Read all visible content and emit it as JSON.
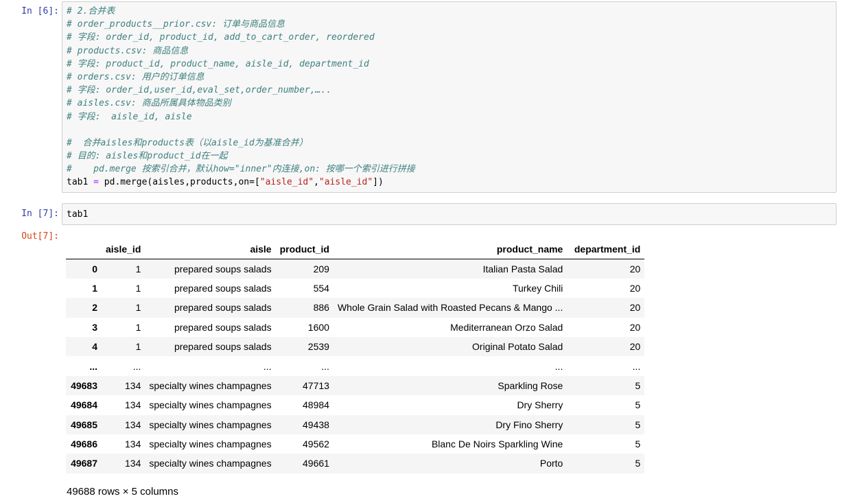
{
  "cell6": {
    "prompt": "In  [6]:",
    "lines": [
      {
        "type": "comment",
        "text": "# 2.合并表"
      },
      {
        "type": "comment",
        "text": "# order_products__prior.csv: 订单与商品信息"
      },
      {
        "type": "comment",
        "text": "# 字段: order_id, product_id, add_to_cart_order, reordered"
      },
      {
        "type": "comment",
        "text": "# products.csv: 商品信息"
      },
      {
        "type": "comment",
        "text": "# 字段: product_id, product_name, aisle_id, department_id"
      },
      {
        "type": "comment",
        "text": "# orders.csv: 用户的订单信息"
      },
      {
        "type": "comment",
        "text": "# 字段: order_id,user_id,eval_set,order_number,….."
      },
      {
        "type": "comment",
        "text": "# aisles.csv: 商品所属具体物品类别"
      },
      {
        "type": "comment",
        "text": "# 字段:  aisle_id, aisle"
      },
      {
        "type": "blank",
        "text": ""
      },
      {
        "type": "comment",
        "text": "#  合并aisles和products表（以aisle_id为基准合并）"
      },
      {
        "type": "comment",
        "text": "# 目的: aisles和product_id在一起"
      },
      {
        "type": "comment",
        "text": "#    pd.merge 按索引合并，默认how=\"inner\"内连接,on: 按哪一个索引进行拼接"
      },
      {
        "type": "code",
        "parts": {
          "a": "tab1 ",
          "op": "=",
          "b": " pd.merge(aisles,products,on=[",
          "s1": "\"aisle_id\"",
          "c": ",",
          "s2": "\"aisle_id\"",
          "d": "])"
        }
      }
    ]
  },
  "cell7": {
    "in_prompt": "In  [7]:",
    "code": "tab1",
    "out_prompt": "Out[7]:"
  },
  "dataframe": {
    "columns": [
      "",
      "aisle_id",
      "aisle",
      "product_id",
      "product_name",
      "department_id"
    ],
    "rows": [
      [
        "0",
        "1",
        "prepared soups salads",
        "209",
        "Italian Pasta Salad",
        "20"
      ],
      [
        "1",
        "1",
        "prepared soups salads",
        "554",
        "Turkey Chili",
        "20"
      ],
      [
        "2",
        "1",
        "prepared soups salads",
        "886",
        "Whole Grain Salad with Roasted Pecans & Mango ...",
        "20"
      ],
      [
        "3",
        "1",
        "prepared soups salads",
        "1600",
        "Mediterranean Orzo Salad",
        "20"
      ],
      [
        "4",
        "1",
        "prepared soups salads",
        "2539",
        "Original Potato Salad",
        "20"
      ],
      [
        "...",
        "...",
        "...",
        "...",
        "...",
        "..."
      ],
      [
        "49683",
        "134",
        "specialty wines champagnes",
        "47713",
        "Sparkling Rose",
        "5"
      ],
      [
        "49684",
        "134",
        "specialty wines champagnes",
        "48984",
        "Dry Sherry",
        "5"
      ],
      [
        "49685",
        "134",
        "specialty wines champagnes",
        "49438",
        "Dry Fino Sherry",
        "5"
      ],
      [
        "49686",
        "134",
        "specialty wines champagnes",
        "49562",
        "Blanc De Noirs Sparkling Wine",
        "5"
      ],
      [
        "49687",
        "134",
        "specialty wines champagnes",
        "49661",
        "Porto",
        "5"
      ]
    ],
    "summary": "49688 rows × 5 columns"
  },
  "colors": {
    "in_prompt": "#303f9f",
    "out_prompt": "#d84315",
    "comment": "#408080",
    "string": "#ba2121",
    "operator": "#aa22ff",
    "cell_background": "#f7f7f7"
  }
}
